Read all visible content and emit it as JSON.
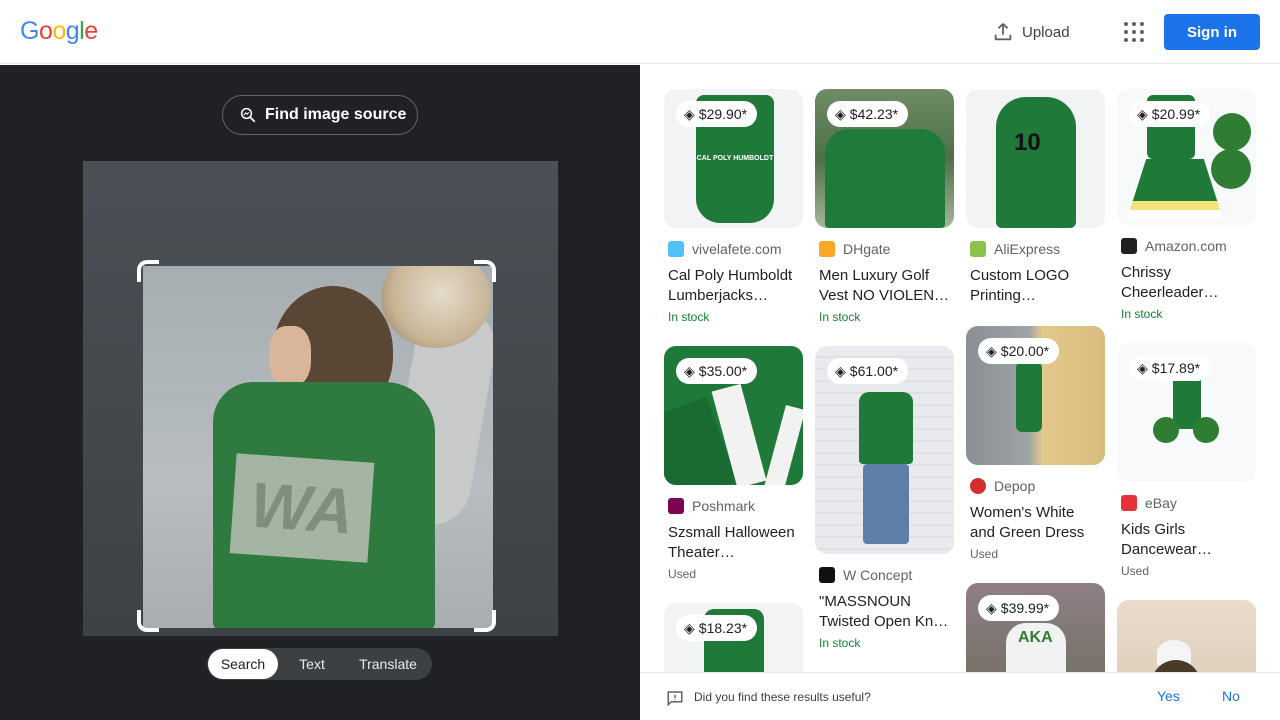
{
  "header": {
    "logo": "Google",
    "upload_label": "Upload",
    "signin_label": "Sign in"
  },
  "lens": {
    "find_source_label": "Find image source",
    "tabs": [
      {
        "label": "Search",
        "active": true
      },
      {
        "label": "Text",
        "active": false
      },
      {
        "label": "Translate",
        "active": false
      }
    ]
  },
  "results": [
    {
      "price": "$29.90*",
      "source": "vivelafete.com",
      "title_lines": [
        "Cal Poly Humboldt",
        "Lumberjacks…"
      ],
      "stock": "In stock",
      "favicon_color": "#4fc3f7"
    },
    {
      "price": "$42.23*",
      "source": "DHgate",
      "title_lines": [
        "Men Luxury Golf",
        "Vest NO VIOLENC…"
      ],
      "stock": "In stock",
      "favicon_color": "#f9a825"
    },
    {
      "price": "",
      "source": "AliExpress",
      "title_lines": [
        "Custom LOGO",
        "Printing…"
      ],
      "stock": "",
      "favicon_color": "#8bc34a"
    },
    {
      "price": "$20.99*",
      "source": "Amazon.com",
      "title_lines": [
        "Chrissy",
        "Cheerleader…"
      ],
      "stock": "In stock",
      "favicon_color": "#212121"
    },
    {
      "price": "$35.00*",
      "source": "Poshmark",
      "title_lines": [
        "Szsmall Halloween",
        "Theater…"
      ],
      "stock": "Used",
      "favicon_color": "#7f0353"
    },
    {
      "price": "$61.00*",
      "source": "W Concept",
      "title_lines": [
        "\"MASSNOUN",
        "Twisted Open Kni…"
      ],
      "stock": "In stock",
      "favicon_color": "#111111"
    },
    {
      "price": "$20.00*",
      "source": "Depop",
      "title_lines": [
        "Women's White",
        "and Green Dress"
      ],
      "stock": "Used",
      "favicon_color": "#d32f2f"
    },
    {
      "price": "$17.89*",
      "source": "eBay",
      "title_lines": [
        "Kids Girls",
        "Dancewear…"
      ],
      "stock": "Used",
      "favicon_color": "#e53238"
    },
    {
      "price": "$18.23*",
      "source": "",
      "title_lines": [],
      "stock": "",
      "favicon_color": ""
    },
    {
      "price": "$39.99*",
      "source": "",
      "title_lines": [],
      "stock": "",
      "favicon_color": ""
    },
    {
      "price": "",
      "source": "",
      "title_lines": [],
      "stock": "",
      "favicon_color": ""
    }
  ],
  "feedback": {
    "question": "Did you find these results useful?",
    "yes_label": "Yes",
    "no_label": "No"
  }
}
